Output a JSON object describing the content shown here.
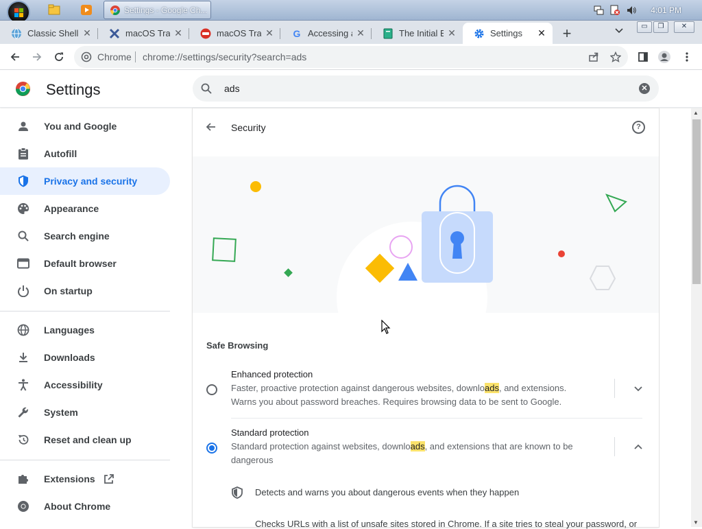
{
  "taskbar": {
    "active_task": "Settings - Google Ch...",
    "clock": "4:01 PM"
  },
  "tabs": [
    {
      "label": "Classic Shell",
      "favicon": "globe-icon",
      "color": "#4a90c2"
    },
    {
      "label": "macOS Trans",
      "favicon": "x-icon",
      "color": "#3b5998"
    },
    {
      "label": "macOS Trans",
      "favicon": "red-badge-icon",
      "color": "#d93025"
    },
    {
      "label": "Accessing an",
      "favicon": "google-icon",
      "color": "#4285f4"
    },
    {
      "label": "The Initial Be",
      "favicon": "doc-icon",
      "color": "#27a77c"
    },
    {
      "label": "Settings",
      "favicon": "gear-icon",
      "color": "#1a73e8"
    }
  ],
  "omnibox": {
    "site": "Chrome",
    "url": "chrome://settings/security?search=ads"
  },
  "settings": {
    "title": "Settings",
    "search_value": "ads"
  },
  "nav": {
    "items": [
      {
        "label": "You and Google",
        "icon": "person-icon"
      },
      {
        "label": "Autofill",
        "icon": "clipboard-icon"
      },
      {
        "label": "Privacy and security",
        "icon": "shield-icon"
      },
      {
        "label": "Appearance",
        "icon": "palette-icon"
      },
      {
        "label": "Search engine",
        "icon": "search-icon"
      },
      {
        "label": "Default browser",
        "icon": "browser-icon"
      },
      {
        "label": "On startup",
        "icon": "power-icon"
      },
      {
        "label": "Languages",
        "icon": "globe-icon"
      },
      {
        "label": "Downloads",
        "icon": "download-icon"
      },
      {
        "label": "Accessibility",
        "icon": "accessibility-icon"
      },
      {
        "label": "System",
        "icon": "wrench-icon"
      },
      {
        "label": "Reset and clean up",
        "icon": "reset-icon"
      },
      {
        "label": "Extensions",
        "icon": "puzzle-icon"
      },
      {
        "label": "About Chrome",
        "icon": "chrome-icon"
      }
    ],
    "selected": "Privacy and security"
  },
  "security": {
    "title": "Security",
    "section_label": "Safe Browsing",
    "enhanced": {
      "title": "Enhanced protection",
      "desc_pre": "Faster, proactive protection against dangerous websites, downlo",
      "desc_hl": "ads",
      "desc_post": ", and extensions. Warns you about password breaches. Requires browsing data to be sent to Google.",
      "selected": false
    },
    "standard": {
      "title": "Standard protection",
      "desc_pre": "Standard protection against websites, downlo",
      "desc_hl": "ads",
      "desc_post": ", and extensions that are known to be dangerous",
      "selected": true
    },
    "detail1": "Detects and warns you about dangerous events when they happen",
    "detail2": "Checks URLs with a list of unsafe sites stored in Chrome. If a site tries to steal your password, or"
  },
  "colors": {
    "accent": "#1a73e8",
    "highlight": "#fbe26b",
    "selected_nav_bg": "#e8f0fe"
  }
}
